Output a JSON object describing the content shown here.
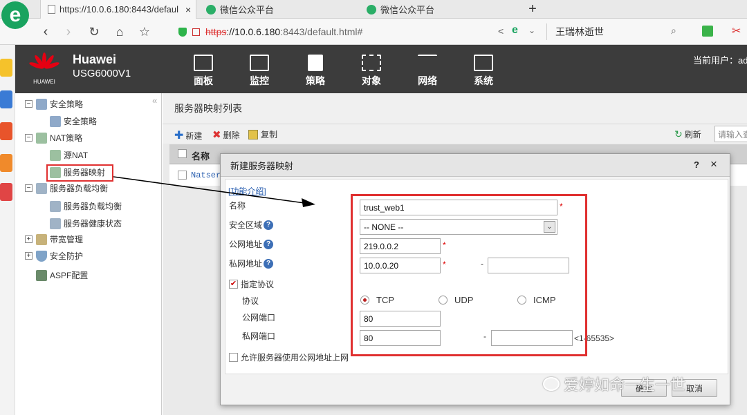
{
  "browser": {
    "tabs": [
      {
        "title": "https://10.0.6.180:8443/defaul",
        "active": true
      },
      {
        "title": "微信公众平台",
        "active": false
      },
      {
        "title": "微信公众平台",
        "active": false
      }
    ],
    "url_scheme": "https",
    "url_host": "://10.0.6.180",
    "url_rest": ":8443/default.html#",
    "search_text": "王瑞林逝世",
    "new_tab": "+",
    "close_tab": "×"
  },
  "app": {
    "brand": "Huawei",
    "model": "USG6000V1",
    "logo_text": "HUAWEI",
    "current_user_label": "当前用户：ad",
    "menu": [
      "面板",
      "监控",
      "策略",
      "对象",
      "网络",
      "系统"
    ]
  },
  "sidebar": {
    "items": [
      {
        "label": "安全策略",
        "level": 0,
        "toggle": "−"
      },
      {
        "label": "安全策略",
        "level": 1
      },
      {
        "label": "NAT策略",
        "level": 0,
        "toggle": "−"
      },
      {
        "label": "源NAT",
        "level": 1
      },
      {
        "label": "服务器映射",
        "level": 1
      },
      {
        "label": "服务器负载均衡",
        "level": 0,
        "toggle": "−"
      },
      {
        "label": "服务器负载均衡",
        "level": 1
      },
      {
        "label": "服务器健康状态",
        "level": 1
      },
      {
        "label": "带宽管理",
        "level": 0,
        "toggle": "+"
      },
      {
        "label": "安全防护",
        "level": 0,
        "toggle": "+"
      },
      {
        "label": "ASPF配置",
        "level": 0
      }
    ],
    "collapse": "«"
  },
  "content": {
    "title": "服务器映射列表",
    "toolbar": {
      "new": "新建",
      "delete": "删除",
      "copy": "复制",
      "refresh": "刷新",
      "search_placeholder": "请输入查"
    },
    "grid": {
      "col_name": "名称",
      "row1": "Natserv"
    }
  },
  "dialog": {
    "title": "新建服务器映射",
    "help": "?",
    "close": "×",
    "intro_link": "[功能介绍]",
    "labels": {
      "name": "名称",
      "zone": "安全区域",
      "public_addr": "公网地址",
      "private_addr": "私网地址",
      "specify_protocol": "指定协议",
      "protocol": "协议",
      "public_port": "公网端口",
      "private_port": "私网端口",
      "allow_internet": "允许服务器使用公网地址上网"
    },
    "values": {
      "name": "trust_web1",
      "zone": "-- NONE --",
      "public_addr": "219.0.0.2",
      "private_addr": "10.0.0.20",
      "private_addr_end": "",
      "public_port": "80",
      "private_port": "80",
      "private_port_end": ""
    },
    "protocols": [
      "TCP",
      "UDP",
      "ICMP"
    ],
    "selected_protocol": "TCP",
    "port_range_hint": "<1-65535>",
    "dash": "-",
    "required": "*",
    "ok": "确定",
    "cancel": "取消"
  },
  "watermark": "爱婷如命一生一世",
  "colors": {
    "highlight_box": "#e03030",
    "header_bg": "#3c3c3c"
  }
}
